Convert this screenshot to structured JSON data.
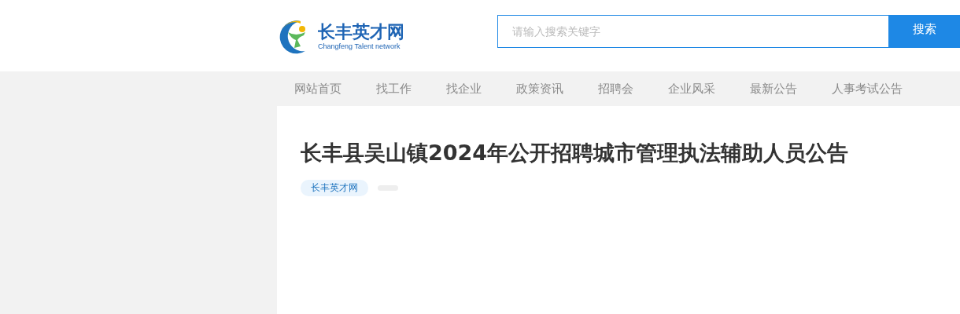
{
  "logo": {
    "name": "长丰英才网",
    "subtitle": "Changfeng Talent network"
  },
  "search": {
    "placeholder": "请输入搜索关键字",
    "button": "搜索"
  },
  "nav": [
    {
      "label": "网站首页"
    },
    {
      "label": "找工作"
    },
    {
      "label": "找企业"
    },
    {
      "label": "政策资讯"
    },
    {
      "label": "招聘会"
    },
    {
      "label": "企业风采"
    },
    {
      "label": "最新公告"
    },
    {
      "label": "人事考试公告"
    }
  ],
  "article": {
    "title": "长丰县吴山镇2024年公开招聘城市管理执法辅助人员公告",
    "source": "长丰英才网"
  }
}
